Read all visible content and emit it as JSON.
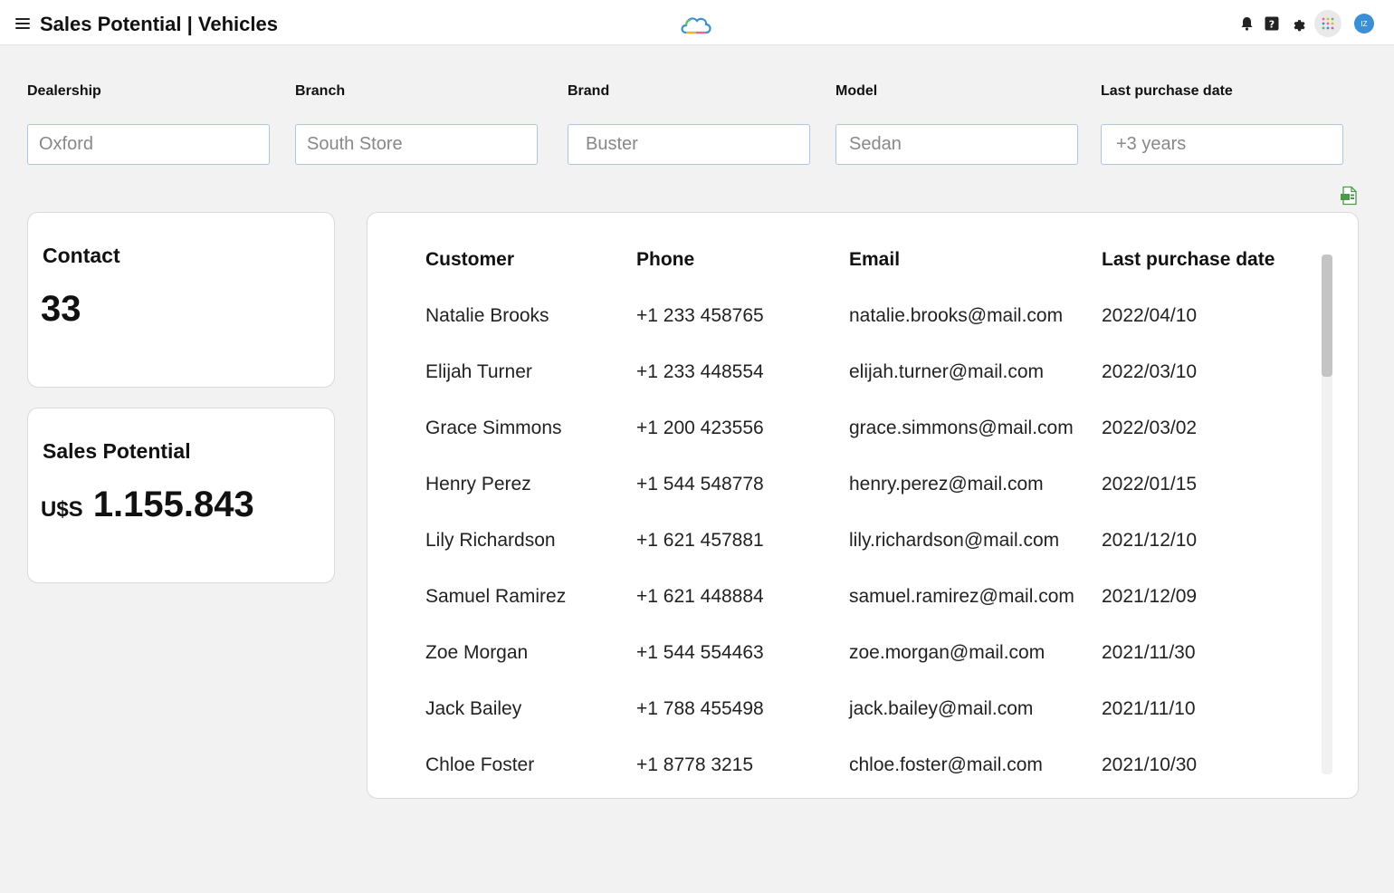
{
  "header": {
    "title": "Sales Potential | Vehicles",
    "icons": [
      "menu-icon",
      "cloud-logo-icon",
      "bell-icon",
      "help-icon",
      "gear-icon",
      "apps-grid-icon"
    ],
    "avatar_initials": "IZ"
  },
  "filters": [
    {
      "label": "Dealership",
      "placeholder": "Oxford"
    },
    {
      "label": "Branch",
      "placeholder": "South Store"
    },
    {
      "label": "Brand",
      "placeholder": "Buster"
    },
    {
      "label": "Model",
      "placeholder": "Sedan"
    },
    {
      "label": "Last purchase date",
      "placeholder": "+3 years"
    }
  ],
  "cards": {
    "contact": {
      "title": "Contact",
      "value": "33"
    },
    "sales": {
      "title": "Sales Potential",
      "currency": "U$S",
      "value": "1.155.843"
    }
  },
  "table": {
    "columns": [
      "Customer",
      "Phone",
      "Email",
      "Last purchase date"
    ],
    "rows": [
      [
        "Natalie Brooks",
        "+1 233 458765",
        "natalie.brooks@mail.com",
        "2022/04/10"
      ],
      [
        "Elijah Turner",
        "+1 233 448554",
        "elijah.turner@mail.com",
        "2022/03/10"
      ],
      [
        "Grace Simmons",
        "+1 200 423556",
        "grace.simmons@mail.com",
        "2022/03/02"
      ],
      [
        "Henry Perez",
        "+1 544 548778",
        "henry.perez@mail.com",
        "2022/01/15"
      ],
      [
        "Lily Richardson",
        "+1 621 457881",
        "lily.richardson@mail.com",
        "2021/12/10"
      ],
      [
        "Samuel Ramirez",
        "+1 621 448884",
        "samuel.ramirez@mail.com",
        "2021/12/09"
      ],
      [
        "Zoe Morgan",
        "+1 544 554463",
        "zoe.morgan@mail.com",
        "2021/11/30"
      ],
      [
        "Jack Bailey",
        "+1 788 455498",
        "jack.bailey@mail.com",
        "2021/11/10"
      ],
      [
        "Chloe Foster",
        "+1 8778 3215",
        "chloe.foster@mail.com",
        "2021/10/30"
      ]
    ]
  },
  "colors": {
    "accent": "#3a8fd6",
    "input_border": "#aac6e2",
    "export_icon": "#4a9a4a"
  }
}
